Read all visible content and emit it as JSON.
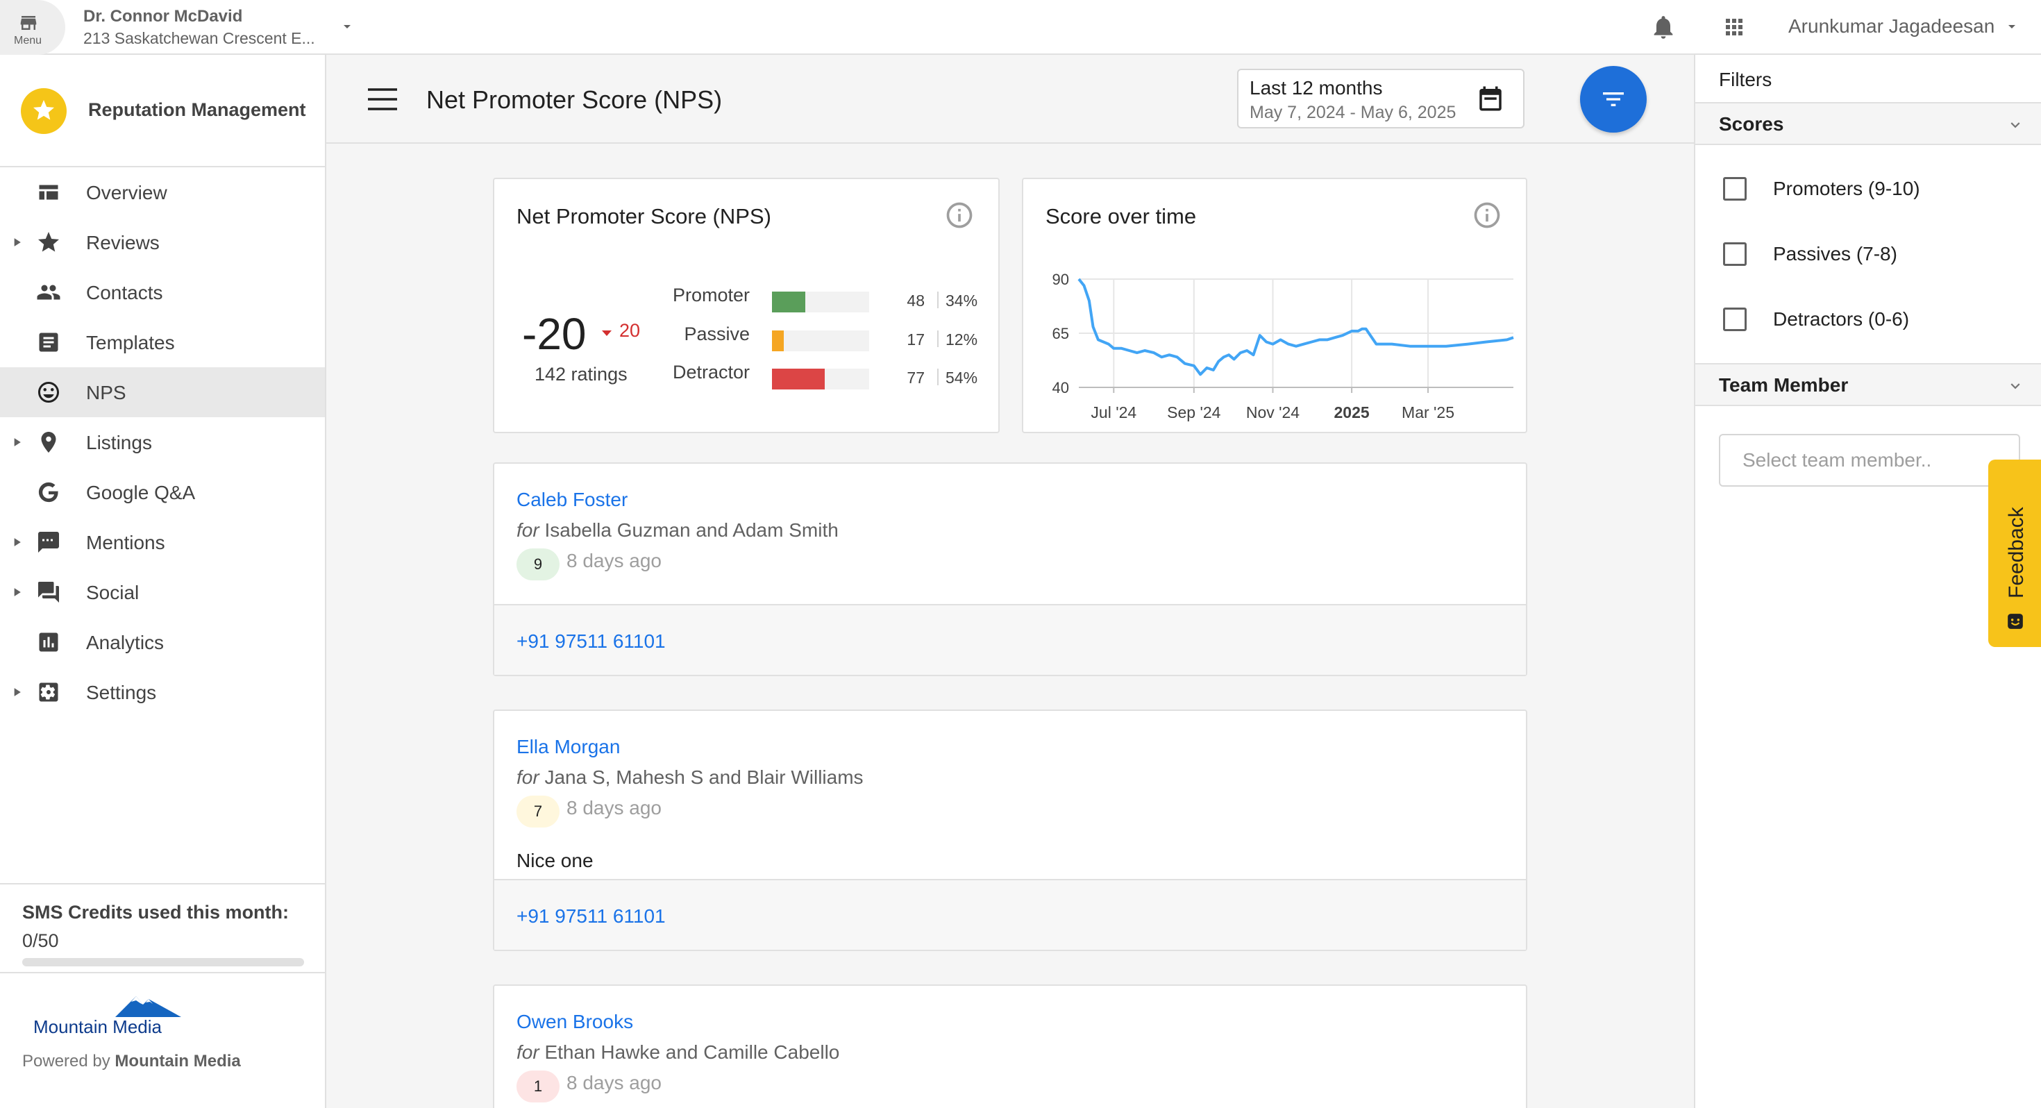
{
  "topbar": {
    "menu_label": "Menu",
    "account_name": "Dr. Connor McDavid",
    "account_address": "213 Saskatchewan Crescent E...",
    "user_name": "Arunkumar Jagadeesan"
  },
  "sidebar": {
    "product_title": "Reputation Management",
    "items": [
      {
        "label": "Overview",
        "icon": "dashboard-icon",
        "expandable": false,
        "active": false
      },
      {
        "label": "Reviews",
        "icon": "star-icon",
        "expandable": true,
        "active": false
      },
      {
        "label": "Contacts",
        "icon": "people-icon",
        "expandable": false,
        "active": false
      },
      {
        "label": "Templates",
        "icon": "document-icon",
        "expandable": false,
        "active": false
      },
      {
        "label": "NPS",
        "icon": "smiley-icon",
        "expandable": false,
        "active": true
      },
      {
        "label": "Listings",
        "icon": "location-pin-icon",
        "expandable": true,
        "active": false
      },
      {
        "label": "Google Q&A",
        "icon": "google-icon",
        "expandable": false,
        "active": false
      },
      {
        "label": "Mentions",
        "icon": "chat-bubble-icon",
        "expandable": true,
        "active": false
      },
      {
        "label": "Social",
        "icon": "forum-icon",
        "expandable": true,
        "active": false
      },
      {
        "label": "Analytics",
        "icon": "bar-chart-icon",
        "expandable": false,
        "active": false
      },
      {
        "label": "Settings",
        "icon": "settings-icon",
        "expandable": true,
        "active": false
      }
    ],
    "sms_title": "SMS Credits used this month:",
    "sms_count": "0/50",
    "sms_used_fraction": 0,
    "brand_name": "Mountain Media",
    "powered_by_prefix": "Powered by",
    "powered_by_name": "Mountain Media"
  },
  "header": {
    "title": "Net Promoter Score (NPS)",
    "date_range": "Last 12 months",
    "date_sub": "May 7, 2024 - May 6, 2025"
  },
  "nps_card": {
    "title": "Net Promoter Score (NPS)",
    "score": "-20",
    "delta": "20",
    "ratings": "142 ratings",
    "distribution": [
      {
        "label": "Promoter",
        "count": "48",
        "pct": "34%",
        "fraction": 0.34,
        "color": "#5a9e5a"
      },
      {
        "label": "Passive",
        "count": "17",
        "pct": "12%",
        "fraction": 0.12,
        "color": "#f5a623"
      },
      {
        "label": "Detractor",
        "count": "77",
        "pct": "54%",
        "fraction": 0.54,
        "color": "#dc4545"
      }
    ]
  },
  "score_card": {
    "title": "Score over time"
  },
  "chart_data": {
    "type": "line",
    "title": "Score over time",
    "ylim": [
      40,
      90
    ],
    "yticks": [
      90,
      65,
      40
    ],
    "xticks": [
      {
        "label": "Jul '24",
        "x": "2024-07-01",
        "bold": false
      },
      {
        "label": "Sep '24",
        "x": "2024-09-01",
        "bold": false
      },
      {
        "label": "Nov '24",
        "x": "2024-11-01",
        "bold": false
      },
      {
        "label": "2025",
        "x": "2025-01-01",
        "bold": true
      },
      {
        "label": "Mar '25",
        "x": "2025-03-01",
        "bold": false
      }
    ],
    "grid": true,
    "line_color": "#42a5f5",
    "series": [
      {
        "x": [
          "2024-06-04",
          "2024-06-08",
          "2024-06-12",
          "2024-06-15",
          "2024-06-19",
          "2024-06-23",
          "2024-06-27",
          "2024-07-01",
          "2024-07-07",
          "2024-07-13",
          "2024-07-19",
          "2024-07-25",
          "2024-08-01",
          "2024-08-07",
          "2024-08-13",
          "2024-08-19",
          "2024-08-25",
          "2024-09-01",
          "2024-09-06",
          "2024-09-11",
          "2024-09-16",
          "2024-09-20",
          "2024-09-24",
          "2024-09-28",
          "2024-10-02",
          "2024-10-07",
          "2024-10-12",
          "2024-10-17",
          "2024-10-22",
          "2024-10-27",
          "2024-11-01",
          "2024-11-07",
          "2024-11-13",
          "2024-11-19",
          "2024-11-25",
          "2024-12-01",
          "2024-12-07",
          "2024-12-13",
          "2024-12-19",
          "2024-12-25",
          "2025-01-01",
          "2025-01-06",
          "2025-01-09",
          "2025-01-12",
          "2025-01-20",
          "2025-02-01",
          "2025-02-15",
          "2025-03-01",
          "2025-03-15",
          "2025-04-01",
          "2025-04-15",
          "2025-05-01",
          "2025-05-06"
        ],
        "y": [
          90,
          87,
          80,
          68,
          62,
          61,
          60,
          58,
          58,
          57,
          56,
          57,
          56,
          54,
          55,
          54,
          51,
          50,
          46,
          49,
          48,
          52,
          54,
          55,
          53,
          56,
          57,
          55,
          64,
          61,
          60,
          62,
          60,
          59,
          60,
          61,
          62,
          62,
          63,
          64,
          66,
          66,
          67,
          67,
          60,
          60,
          59,
          59,
          59,
          60,
          61,
          62,
          63
        ]
      }
    ]
  },
  "reviews": [
    {
      "name": "Caleb Foster",
      "for_prefix": "for",
      "for_names": "Isabella Guzman and Adam Smith",
      "score": "9",
      "score_bg": "#e3f3e3",
      "time": "8 days ago",
      "text": "",
      "phone": "+91 97511 61101"
    },
    {
      "name": "Ella Morgan",
      "for_prefix": "for",
      "for_names": "Jana S, Mahesh S and Blair Williams",
      "score": "7",
      "score_bg": "#fff7dd",
      "time": "8 days ago",
      "text": "Nice one",
      "phone": "+91 97511 61101"
    },
    {
      "name": "Owen Brooks",
      "for_prefix": "for",
      "for_names": "Ethan Hawke and Camille Cabello",
      "score": "1",
      "score_bg": "#fde4e4",
      "time": "8 days ago",
      "text": "",
      "phone": ""
    }
  ],
  "filters": {
    "title": "Filters",
    "scores_title": "Scores",
    "score_options": [
      "Promoters (9-10)",
      "Passives (7-8)",
      "Detractors (0-6)"
    ],
    "team_title": "Team Member",
    "team_placeholder": "Select team member.."
  },
  "feedback": {
    "label": "Feedback"
  }
}
